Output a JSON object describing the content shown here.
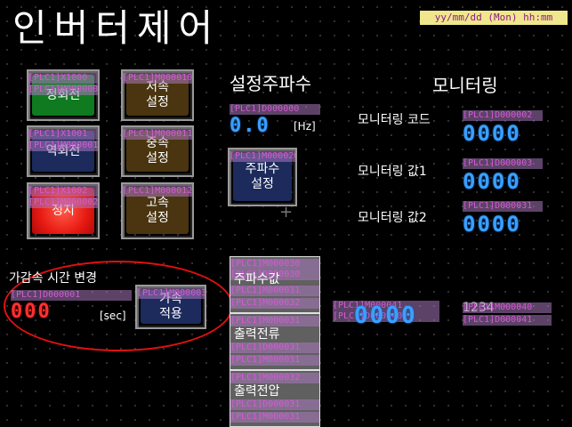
{
  "title": "인버터제어",
  "datetime": "yy/mm/dd (Mon) hh:mm",
  "buttons": {
    "forward": {
      "label": "정회전",
      "tag1": "[PLC1]X1000",
      "tag2": "[PLC1]M000000"
    },
    "reverse": {
      "label": "역회전",
      "tag1": "[PLC1]X1001",
      "tag2": "[PLC1]M000001"
    },
    "stop": {
      "label": "정지",
      "tag1": "[PLC1]X1002",
      "tag2": "[PLC1]M000002"
    },
    "low": {
      "label": "저속\n설정",
      "tag1": "[PLC1]M000010"
    },
    "mid": {
      "label": "중속\n설정",
      "tag1": "[PLC1]M000011"
    },
    "high": {
      "label": "고속\n설정",
      "tag1": "[PLC1]M000012"
    }
  },
  "freq_setting": {
    "heading": "설정주파수",
    "tag": "[PLC1]D000000",
    "value": "0.0",
    "unit": "[Hz]",
    "apply_button": {
      "label": "주파수\n설정",
      "tag": "[PLC1]M000020"
    },
    "plus": "+"
  },
  "accel": {
    "heading": "가감속 시간 변경",
    "tag": "[PLC1]D000001",
    "value": "000",
    "unit": "[sec]",
    "apply_button": {
      "label": "가속\n적용",
      "tag": "[PLC1]M000003"
    }
  },
  "monitoring": {
    "heading": "모니터링",
    "rows": [
      {
        "label": "모니터링 코드",
        "tag": "[PLC1]D000002",
        "value": "0000"
      },
      {
        "label": "모니터링 값1",
        "tag": "[PLC1]D000003",
        "value": "0000"
      },
      {
        "label": "모니터링 값2",
        "tag": "[PLC1]D000031",
        "value": "0000"
      }
    ]
  },
  "grey_tiles": [
    {
      "label": "주파수값",
      "tags": [
        "[PLC1]M000030",
        "[PLC1]D000030",
        "[PLC1]M000031",
        "[PLC1]M000032"
      ]
    },
    {
      "label": "출력전류",
      "tags": [
        "[PLC1]M000031",
        "[PLC1]D000031",
        "[PLC1]M000031",
        "[PLC1]M000032"
      ]
    },
    {
      "label": "출력전압",
      "tags": [
        "[PLC1]M000032",
        "[PLC1]D000031",
        "[PLC1]D000031",
        "[PLC1]M000031"
      ]
    }
  ],
  "readout": {
    "tag1": "[PLC1]M000041",
    "tag2": "[PLC1]D000040",
    "value": "0000",
    "text": "1234",
    "tag3": "[PLC1]M000040",
    "tag4": "[PLC1]D000041"
  }
}
